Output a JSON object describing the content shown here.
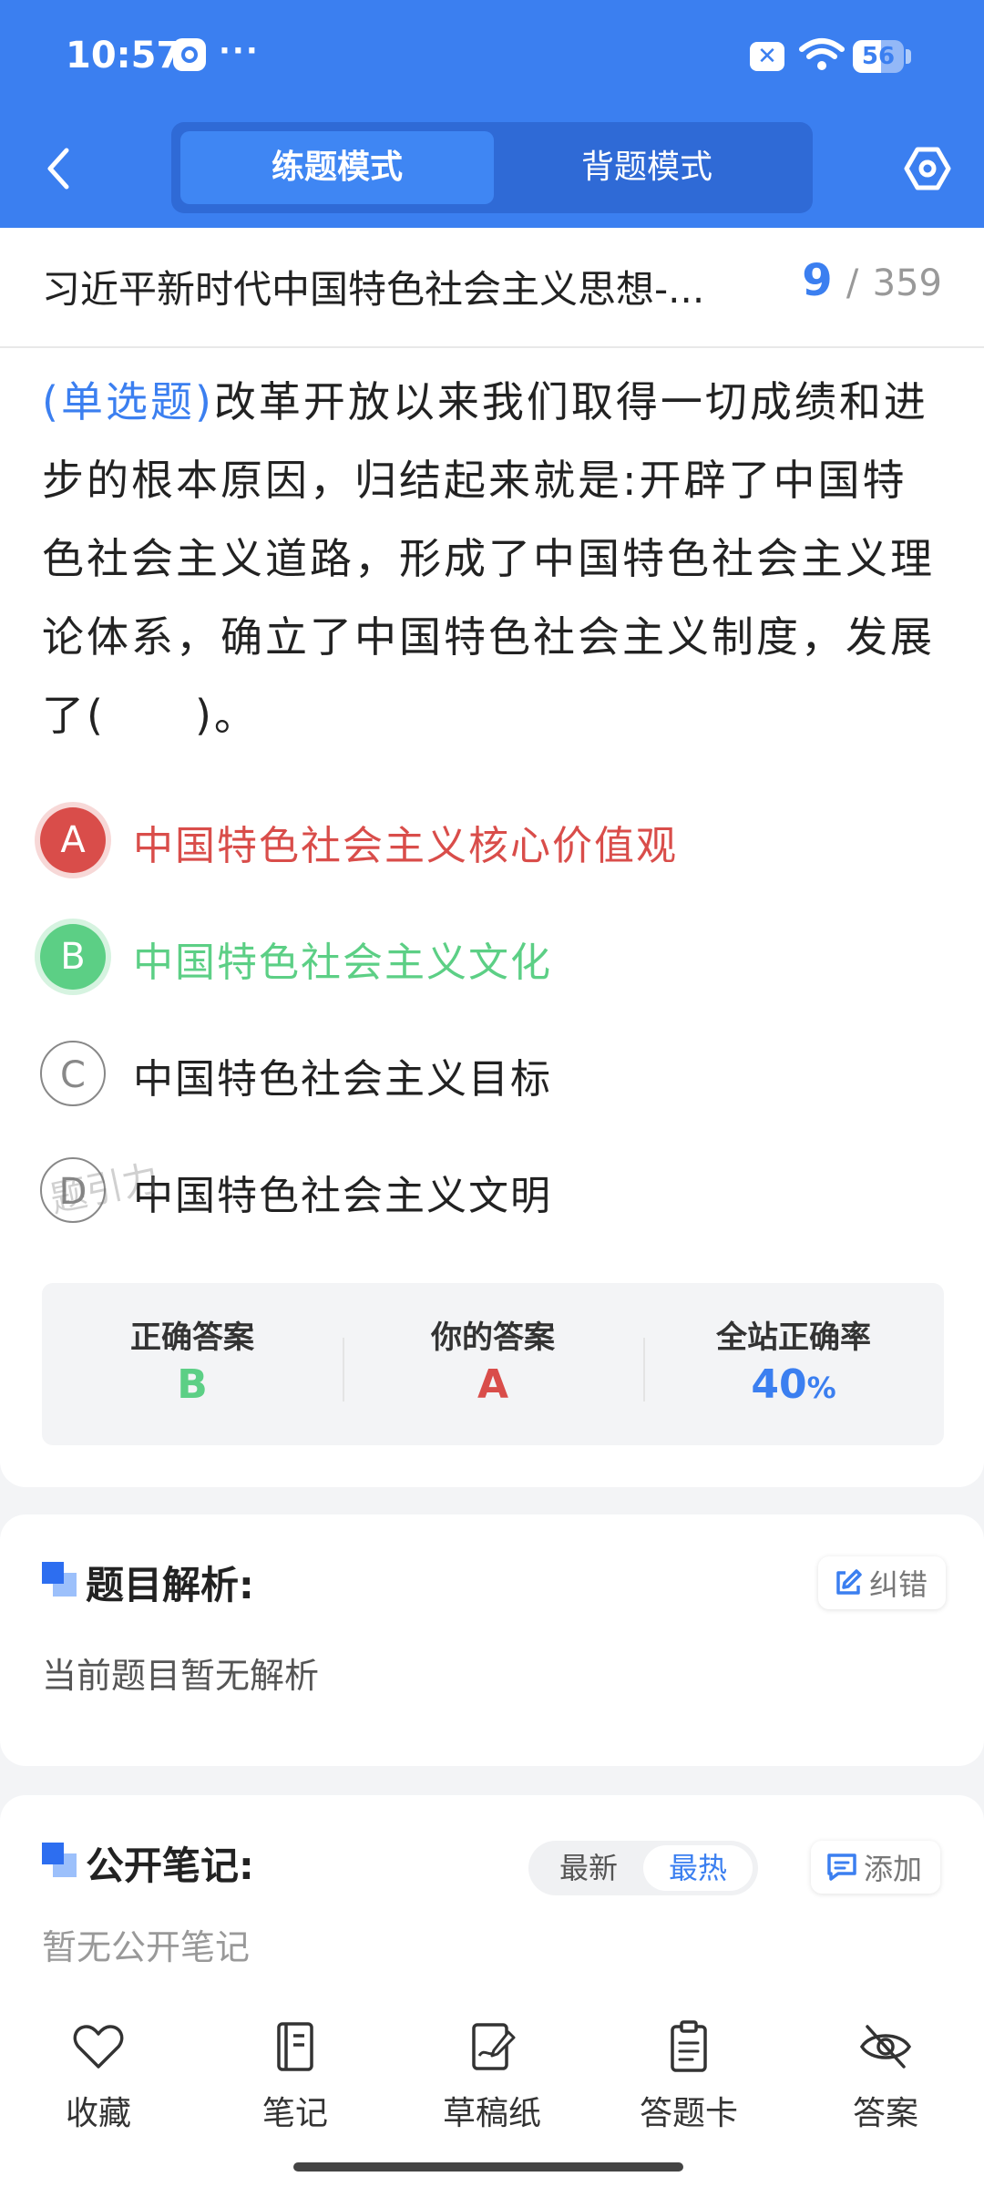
{
  "status_bar": {
    "time": "10:57",
    "more": "···",
    "battery": "56",
    "battery_level": 0.56
  },
  "header": {
    "tabs": [
      {
        "label": "练题模式",
        "active": true
      },
      {
        "label": "背题模式",
        "active": false
      }
    ],
    "accent_color": "#3b7ff0"
  },
  "question": {
    "chapter_title": "习近平新时代中国特色社会主义思想-...",
    "current_index": "9",
    "separator": "/",
    "total": "359",
    "type": "(单选题)",
    "text": "改革开放以来我们取得一切成绩和进步的根本原因，归结起来就是:开辟了中国特色社会主义道路，形成了中国特色社会主义理论体系，确立了中国特色社会主义制度，发展了(　　)。",
    "options": [
      {
        "letter": "A",
        "text": "中国特色社会主义核心价值观",
        "state": "wrong"
      },
      {
        "letter": "B",
        "text": "中国特色社会主义文化",
        "state": "correct"
      },
      {
        "letter": "C",
        "text": "中国特色社会主义目标",
        "state": "normal"
      },
      {
        "letter": "D",
        "text": "中国特色社会主义文明",
        "state": "normal"
      }
    ],
    "watermark": "题引力"
  },
  "result": {
    "correct_label": "正确答案",
    "correct_value": "B",
    "mine_label": "你的答案",
    "mine_value": "A",
    "rate_label": "全站正确率",
    "rate_value": "40",
    "rate_unit": "%",
    "colors": {
      "correct": "#5ccf85",
      "wrong": "#d94d4a",
      "rate": "#3b7ff0"
    }
  },
  "analysis": {
    "title": "题目解析:",
    "report_button": "纠错",
    "body": "当前题目暂无解析"
  },
  "notes": {
    "title": "公开笔记:",
    "sort_latest": "最新",
    "sort_hot": "最热",
    "active_sort": "最热",
    "add_button": "添加",
    "body": "暂无公开笔记"
  },
  "bottom_nav": [
    {
      "label": "收藏",
      "icon": "heart-icon"
    },
    {
      "label": "笔记",
      "icon": "notebook-icon"
    },
    {
      "label": "草稿纸",
      "icon": "draft-pen-icon"
    },
    {
      "label": "答题卡",
      "icon": "clipboard-icon"
    },
    {
      "label": "答案",
      "icon": "eye-off-icon"
    }
  ]
}
